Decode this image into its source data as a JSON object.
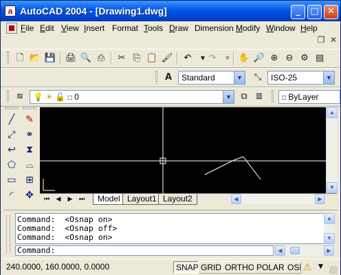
{
  "window": {
    "title": "AutoCAD 2004 - [Drawing1.dwg]",
    "minimize_glyph": "_",
    "maximize_glyph": "□",
    "close_glyph": "✕",
    "doc_restore_glyph": "❐",
    "doc_close_glyph": "✕"
  },
  "menu": {
    "items": [
      {
        "label": "File",
        "key": "F",
        "rest": "ile"
      },
      {
        "label": "Edit",
        "key": "E",
        "rest": "dit"
      },
      {
        "label": "View",
        "key": "V",
        "rest": "iew"
      },
      {
        "label": "Insert",
        "key": "I",
        "rest": "nsert"
      },
      {
        "label": "Format",
        "key": "",
        "rest": "Format"
      },
      {
        "label": "Tools",
        "key": "T",
        "rest": "ools"
      },
      {
        "label": "Draw",
        "key": "D",
        "rest": "raw"
      },
      {
        "label": "Dimension",
        "key": "",
        "rest": "Dimension"
      },
      {
        "label": "Modify",
        "key": "M",
        "rest": "odify"
      },
      {
        "label": "Window",
        "key": "W",
        "rest": "indow"
      },
      {
        "label": "Help",
        "key": "H",
        "rest": "elp"
      }
    ]
  },
  "styles_toolbar": {
    "text_style": "Standard",
    "dim_style": "ISO-25"
  },
  "layers_toolbar": {
    "current_layer": "0",
    "color": "ByLayer"
  },
  "layout_tabs": {
    "tabs": [
      "Model",
      "Layout1",
      "Layout2"
    ],
    "active": "Model"
  },
  "command_window": {
    "history": [
      "Command:  <Osnap on>",
      "Command:  <Osnap off>",
      "Command:  <Osnap on>"
    ],
    "prompt": "Command:"
  },
  "status_bar": {
    "coordinates": "240.0000, 160.0000, 0.0000",
    "toggles": [
      "SNAP",
      "GRID",
      "ORTHO",
      "POLAR",
      "OSN"
    ],
    "active_toggles": [
      "SNAP"
    ]
  },
  "colors": {
    "title_bar": "#0058E6",
    "canvas_background": "#000000",
    "drawing_lines": "#FFFFFF"
  }
}
